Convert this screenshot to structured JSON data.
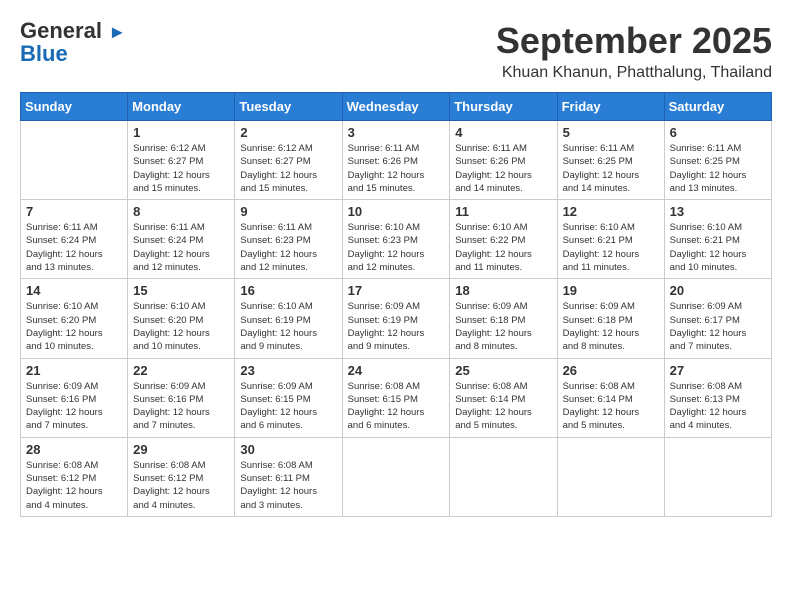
{
  "logo": {
    "general": "General",
    "blue": "Blue"
  },
  "title": "September 2025",
  "location": "Khuan Khanun, Phatthalung, Thailand",
  "weekdays": [
    "Sunday",
    "Monday",
    "Tuesday",
    "Wednesday",
    "Thursday",
    "Friday",
    "Saturday"
  ],
  "weeks": [
    [
      {
        "day": "",
        "info": ""
      },
      {
        "day": "1",
        "info": "Sunrise: 6:12 AM\nSunset: 6:27 PM\nDaylight: 12 hours\nand 15 minutes."
      },
      {
        "day": "2",
        "info": "Sunrise: 6:12 AM\nSunset: 6:27 PM\nDaylight: 12 hours\nand 15 minutes."
      },
      {
        "day": "3",
        "info": "Sunrise: 6:11 AM\nSunset: 6:26 PM\nDaylight: 12 hours\nand 15 minutes."
      },
      {
        "day": "4",
        "info": "Sunrise: 6:11 AM\nSunset: 6:26 PM\nDaylight: 12 hours\nand 14 minutes."
      },
      {
        "day": "5",
        "info": "Sunrise: 6:11 AM\nSunset: 6:25 PM\nDaylight: 12 hours\nand 14 minutes."
      },
      {
        "day": "6",
        "info": "Sunrise: 6:11 AM\nSunset: 6:25 PM\nDaylight: 12 hours\nand 13 minutes."
      }
    ],
    [
      {
        "day": "7",
        "info": "Sunrise: 6:11 AM\nSunset: 6:24 PM\nDaylight: 12 hours\nand 13 minutes."
      },
      {
        "day": "8",
        "info": "Sunrise: 6:11 AM\nSunset: 6:24 PM\nDaylight: 12 hours\nand 12 minutes."
      },
      {
        "day": "9",
        "info": "Sunrise: 6:11 AM\nSunset: 6:23 PM\nDaylight: 12 hours\nand 12 minutes."
      },
      {
        "day": "10",
        "info": "Sunrise: 6:10 AM\nSunset: 6:23 PM\nDaylight: 12 hours\nand 12 minutes."
      },
      {
        "day": "11",
        "info": "Sunrise: 6:10 AM\nSunset: 6:22 PM\nDaylight: 12 hours\nand 11 minutes."
      },
      {
        "day": "12",
        "info": "Sunrise: 6:10 AM\nSunset: 6:21 PM\nDaylight: 12 hours\nand 11 minutes."
      },
      {
        "day": "13",
        "info": "Sunrise: 6:10 AM\nSunset: 6:21 PM\nDaylight: 12 hours\nand 10 minutes."
      }
    ],
    [
      {
        "day": "14",
        "info": "Sunrise: 6:10 AM\nSunset: 6:20 PM\nDaylight: 12 hours\nand 10 minutes."
      },
      {
        "day": "15",
        "info": "Sunrise: 6:10 AM\nSunset: 6:20 PM\nDaylight: 12 hours\nand 10 minutes."
      },
      {
        "day": "16",
        "info": "Sunrise: 6:10 AM\nSunset: 6:19 PM\nDaylight: 12 hours\nand 9 minutes."
      },
      {
        "day": "17",
        "info": "Sunrise: 6:09 AM\nSunset: 6:19 PM\nDaylight: 12 hours\nand 9 minutes."
      },
      {
        "day": "18",
        "info": "Sunrise: 6:09 AM\nSunset: 6:18 PM\nDaylight: 12 hours\nand 8 minutes."
      },
      {
        "day": "19",
        "info": "Sunrise: 6:09 AM\nSunset: 6:18 PM\nDaylight: 12 hours\nand 8 minutes."
      },
      {
        "day": "20",
        "info": "Sunrise: 6:09 AM\nSunset: 6:17 PM\nDaylight: 12 hours\nand 7 minutes."
      }
    ],
    [
      {
        "day": "21",
        "info": "Sunrise: 6:09 AM\nSunset: 6:16 PM\nDaylight: 12 hours\nand 7 minutes."
      },
      {
        "day": "22",
        "info": "Sunrise: 6:09 AM\nSunset: 6:16 PM\nDaylight: 12 hours\nand 7 minutes."
      },
      {
        "day": "23",
        "info": "Sunrise: 6:09 AM\nSunset: 6:15 PM\nDaylight: 12 hours\nand 6 minutes."
      },
      {
        "day": "24",
        "info": "Sunrise: 6:08 AM\nSunset: 6:15 PM\nDaylight: 12 hours\nand 6 minutes."
      },
      {
        "day": "25",
        "info": "Sunrise: 6:08 AM\nSunset: 6:14 PM\nDaylight: 12 hours\nand 5 minutes."
      },
      {
        "day": "26",
        "info": "Sunrise: 6:08 AM\nSunset: 6:14 PM\nDaylight: 12 hours\nand 5 minutes."
      },
      {
        "day": "27",
        "info": "Sunrise: 6:08 AM\nSunset: 6:13 PM\nDaylight: 12 hours\nand 4 minutes."
      }
    ],
    [
      {
        "day": "28",
        "info": "Sunrise: 6:08 AM\nSunset: 6:12 PM\nDaylight: 12 hours\nand 4 minutes."
      },
      {
        "day": "29",
        "info": "Sunrise: 6:08 AM\nSunset: 6:12 PM\nDaylight: 12 hours\nand 4 minutes."
      },
      {
        "day": "30",
        "info": "Sunrise: 6:08 AM\nSunset: 6:11 PM\nDaylight: 12 hours\nand 3 minutes."
      },
      {
        "day": "",
        "info": ""
      },
      {
        "day": "",
        "info": ""
      },
      {
        "day": "",
        "info": ""
      },
      {
        "day": "",
        "info": ""
      }
    ]
  ]
}
